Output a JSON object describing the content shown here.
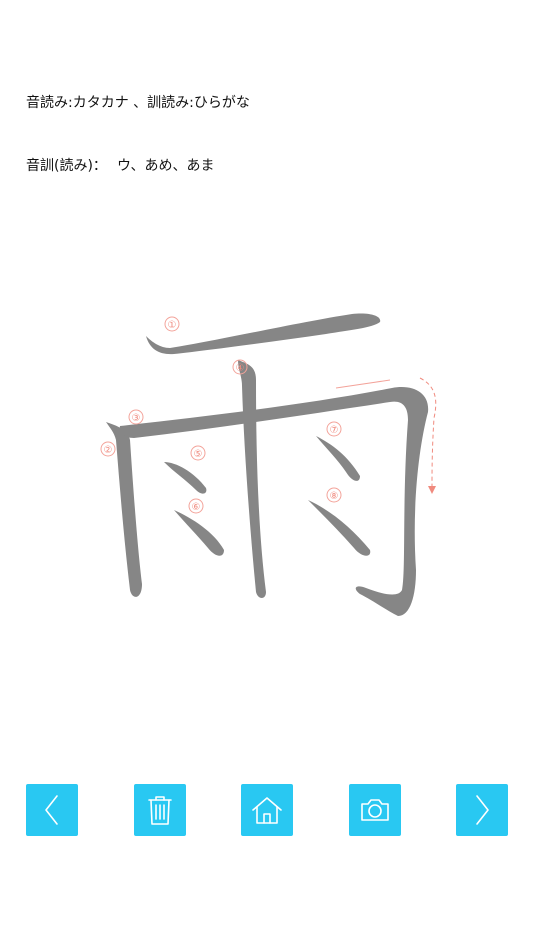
{
  "reading_legend": "音読み:カタカナ 、訓読み:ひらがな",
  "readings": {
    "label": "音訓(読み)：",
    "value": "ウ、あめ、あま"
  },
  "kanji": {
    "character": "雨",
    "stroke_count": 8,
    "stroke_numbers": [
      "①",
      "②",
      "③",
      "④",
      "⑤",
      "⑥",
      "⑦",
      "⑧"
    ],
    "stroke_color": "#868686",
    "guide_color": "#f08a7e"
  },
  "toolbar": {
    "color": "#29c8f2",
    "buttons": [
      {
        "id": "prev",
        "icon": "chevron-left-icon"
      },
      {
        "id": "clear",
        "icon": "trash-icon"
      },
      {
        "id": "home",
        "icon": "home-icon"
      },
      {
        "id": "camera",
        "icon": "camera-icon"
      },
      {
        "id": "next",
        "icon": "chevron-right-icon"
      }
    ]
  }
}
